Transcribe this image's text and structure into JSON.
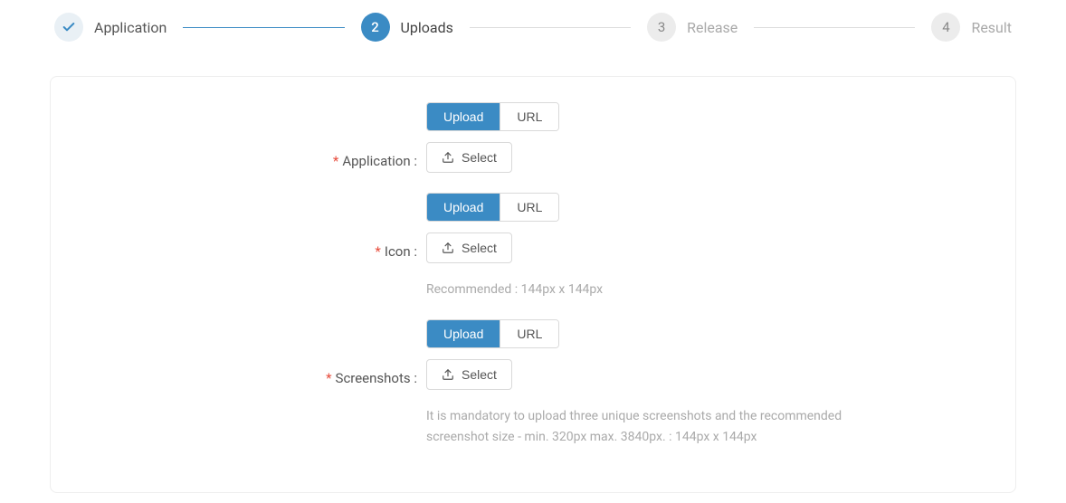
{
  "stepper": {
    "steps": [
      {
        "label": "Application",
        "state": "done"
      },
      {
        "label": "Uploads",
        "state": "active",
        "number": "2"
      },
      {
        "label": "Release",
        "state": "pending",
        "number": "3"
      },
      {
        "label": "Result",
        "state": "pending",
        "number": "4"
      }
    ]
  },
  "form": {
    "application": {
      "label": "Application :",
      "upload_tab": "Upload",
      "url_tab": "URL",
      "select_label": "Select"
    },
    "icon": {
      "label": "Icon :",
      "upload_tab": "Upload",
      "url_tab": "URL",
      "select_label": "Select",
      "hint": "Recommended : 144px x 144px"
    },
    "screenshots": {
      "label": "Screenshots :",
      "upload_tab": "Upload",
      "url_tab": "URL",
      "select_label": "Select",
      "hint": "It is mandatory to upload three unique screenshots and the recommended screenshot size - min. 320px max. 3840px. : 144px x 144px"
    }
  }
}
